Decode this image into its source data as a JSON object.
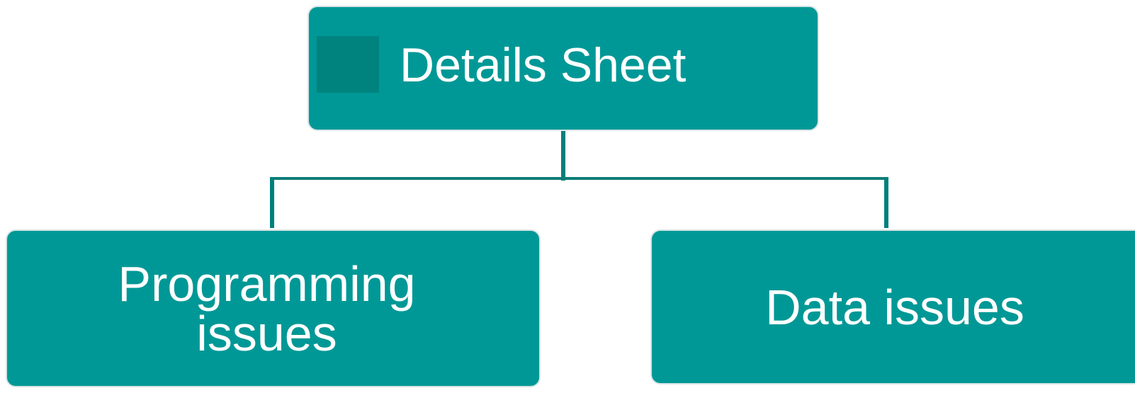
{
  "diagram": {
    "root": {
      "label": "Details Sheet"
    },
    "children": [
      {
        "label": "Programming issues"
      },
      {
        "label": "Data issues"
      }
    ]
  },
  "colors": {
    "node_fill": "#009896",
    "marker_fill": "#00837f",
    "connector": "#00807c",
    "text": "#ffffff"
  }
}
